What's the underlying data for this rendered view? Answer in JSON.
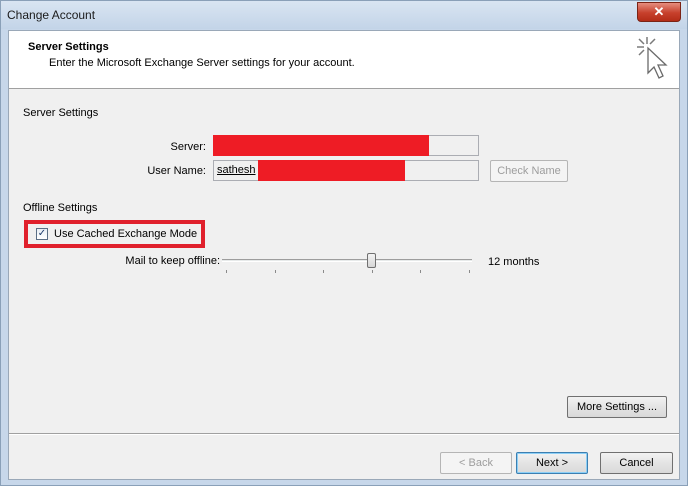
{
  "window": {
    "title": "Change Account",
    "close_glyph": "✕"
  },
  "header": {
    "title": "Server Settings",
    "subtitle": "Enter the Microsoft Exchange Server settings for your account.",
    "icon": "cursor-sparkle-icon"
  },
  "server_settings": {
    "section_label": "Server Settings",
    "server_label": "Server:",
    "server_value": "",
    "username_label": "User Name:",
    "username_value": "sathesh",
    "check_name_label": "Check Name",
    "redaction_color": "#ee1c25"
  },
  "offline_settings": {
    "section_label": "Offline Settings",
    "cached_mode_label": "Use Cached Exchange Mode",
    "cached_mode_checked": true,
    "check_glyph": "✓",
    "mail_offline_label": "Mail to keep offline:",
    "slider_value_text": "12 months",
    "slider_fraction": 0.6,
    "highlight_color": "#e0202c"
  },
  "buttons": {
    "more_settings": "More Settings ...",
    "back": "< Back",
    "next": "Next >",
    "cancel": "Cancel"
  }
}
